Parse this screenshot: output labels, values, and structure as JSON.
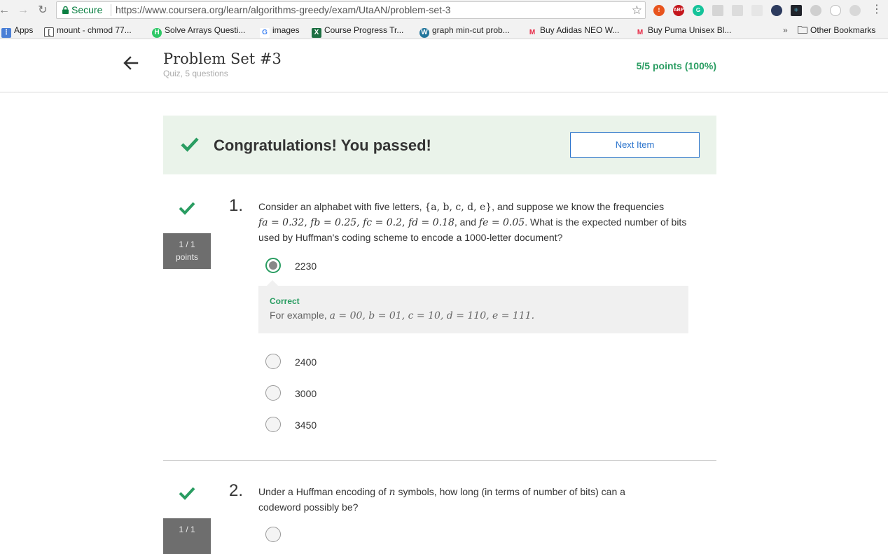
{
  "browser": {
    "secure_label": "Secure",
    "url": "https://www.coursera.org/learn/algorithms-greedy/exam/UtaAN/problem-set-3",
    "extensions": [
      "alert-icon",
      "adblock-icon",
      "grammarly-icon",
      "ext-icon",
      "ext-icon",
      "ext-icon",
      "ext-icon",
      "react-icon",
      "ext-icon",
      "ext-icon",
      "ext-icon"
    ]
  },
  "bookmarks": {
    "items": [
      {
        "label": "Apps",
        "icon": "apps-grid-icon"
      },
      {
        "label": "mount - chmod 77...",
        "icon": "bookmark-page-icon"
      },
      {
        "label": "Solve Arrays Questi...",
        "icon": "hackerrank-icon"
      },
      {
        "label": "images",
        "icon": "google-icon"
      },
      {
        "label": "Course Progress Tr...",
        "icon": "sheets-icon"
      },
      {
        "label": "graph min-cut prob...",
        "icon": "wordpress-icon"
      },
      {
        "label": "Buy Adidas NEO W...",
        "icon": "myntra-icon"
      },
      {
        "label": "Buy Puma Unisex Bl...",
        "icon": "myntra-icon"
      }
    ],
    "overflow": "»",
    "other_label": "Other Bookmarks"
  },
  "header": {
    "title": "Problem Set #3",
    "subtitle": "Quiz, 5 questions",
    "score": "5/5 points (100%)"
  },
  "banner": {
    "message": "Congratulations! You passed!",
    "next_label": "Next Item"
  },
  "questions": [
    {
      "number": "1.",
      "points_line1": "1 / 1",
      "points_line2": "points",
      "text_intro": "Consider an alphabet with five letters, ",
      "text_set": "{a, b, c, d, e}",
      "text_mid": ", and suppose we know the frequencies",
      "freq_a": "f",
      "freq_line": "= 0.32, f",
      "text_rest": "= 0.25, f",
      "freqs": [
        "fa = 0.32",
        "fb = 0.25",
        "fc = 0.2",
        "fd = 0.18",
        "fe = 0.05"
      ],
      "text_end": ". What is the expected number of bits used by Huffman's coding scheme to encode a 1000-letter document?",
      "options": [
        "2230",
        "2400",
        "3000",
        "3450"
      ],
      "selected": 0,
      "feedback_label": "Correct",
      "feedback_prefix": "For example, ",
      "feedback_math": "a = 00, b = 01, c = 10, d = 110, e = 111."
    },
    {
      "number": "2.",
      "points_line1": "1 / 1",
      "text_before": "Under a Huffman encoding of ",
      "text_var": "n",
      "text_after": " symbols, how long (in terms of number of bits) can a codeword possibly be?"
    }
  ],
  "colors": {
    "success": "#2a9d62",
    "link": "#2a73cc",
    "banner_bg": "#eaf3ea",
    "points_bg": "#6e6e6e"
  }
}
